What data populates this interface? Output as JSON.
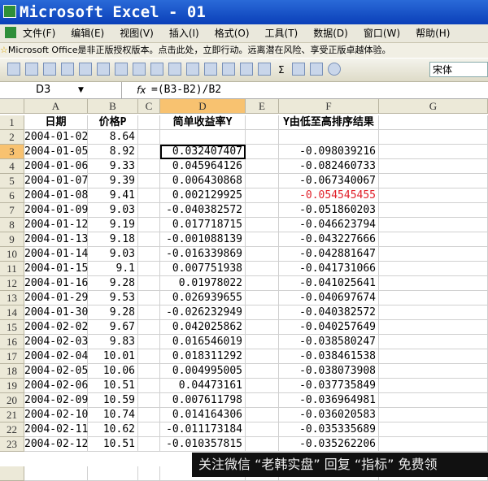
{
  "window": {
    "title": "Microsoft Excel - 01"
  },
  "menu": [
    "文件(F)",
    "编辑(E)",
    "视图(V)",
    "插入(I)",
    "格式(O)",
    "工具(T)",
    "数据(D)",
    "窗口(W)",
    "帮助(H)"
  ],
  "notice": "Microsoft Office是非正版授权版本。点击此处，立即行动。远离潜在风险、享受正版卓越体验。",
  "toolbar": {
    "sigma": "Σ",
    "font": "宋体"
  },
  "formula_bar": {
    "name_box": "D3",
    "fx": "fx",
    "formula": "=(B3-B2)/B2"
  },
  "columns": [
    "A",
    "B",
    "C",
    "D",
    "E",
    "F",
    "G"
  ],
  "headers": {
    "a": "日期",
    "b": "价格P",
    "d": "简单收益率Y",
    "f": "Y由低至高排序结果"
  },
  "rows": [
    {
      "n": "2",
      "a": "2004-01-02",
      "b": "8.64",
      "d": "",
      "f": ""
    },
    {
      "n": "3",
      "a": "2004-01-05",
      "b": "8.92",
      "d": "0.032407407",
      "f": "-0.098039216"
    },
    {
      "n": "4",
      "a": "2004-01-06",
      "b": "9.33",
      "d": "0.045964126",
      "f": "-0.082460733"
    },
    {
      "n": "5",
      "a": "2004-01-07",
      "b": "9.39",
      "d": "0.006430868",
      "f": "-0.067340067"
    },
    {
      "n": "6",
      "a": "2004-01-08",
      "b": "9.41",
      "d": "0.002129925",
      "f": "-0.054545455"
    },
    {
      "n": "7",
      "a": "2004-01-09",
      "b": "9.03",
      "d": "-0.040382572",
      "f": "-0.051860203"
    },
    {
      "n": "8",
      "a": "2004-01-12",
      "b": "9.19",
      "d": "0.017718715",
      "f": "-0.046623794"
    },
    {
      "n": "9",
      "a": "2004-01-13",
      "b": "9.18",
      "d": "-0.001088139",
      "f": "-0.043227666"
    },
    {
      "n": "10",
      "a": "2004-01-14",
      "b": "9.03",
      "d": "-0.016339869",
      "f": "-0.042881647"
    },
    {
      "n": "11",
      "a": "2004-01-15",
      "b": "9.1",
      "d": "0.007751938",
      "f": "-0.041731066"
    },
    {
      "n": "12",
      "a": "2004-01-16",
      "b": "9.28",
      "d": "0.01978022",
      "f": "-0.041025641"
    },
    {
      "n": "13",
      "a": "2004-01-29",
      "b": "9.53",
      "d": "0.026939655",
      "f": "-0.040697674"
    },
    {
      "n": "14",
      "a": "2004-01-30",
      "b": "9.28",
      "d": "-0.026232949",
      "f": "-0.040382572"
    },
    {
      "n": "15",
      "a": "2004-02-02",
      "b": "9.67",
      "d": "0.042025862",
      "f": "-0.040257649"
    },
    {
      "n": "16",
      "a": "2004-02-03",
      "b": "9.83",
      "d": "0.016546019",
      "f": "-0.038580247"
    },
    {
      "n": "17",
      "a": "2004-02-04",
      "b": "10.01",
      "d": "0.018311292",
      "f": "-0.038461538"
    },
    {
      "n": "18",
      "a": "2004-02-05",
      "b": "10.06",
      "d": "0.004995005",
      "f": "-0.038073908"
    },
    {
      "n": "19",
      "a": "2004-02-06",
      "b": "10.51",
      "d": "0.04473161",
      "f": "-0.037735849"
    },
    {
      "n": "20",
      "a": "2004-02-09",
      "b": "10.59",
      "d": "0.007611798",
      "f": "-0.036964981"
    },
    {
      "n": "21",
      "a": "2004-02-10",
      "b": "10.74",
      "d": "0.014164306",
      "f": "-0.036020583"
    },
    {
      "n": "22",
      "a": "2004-02-11",
      "b": "10.62",
      "d": "-0.011173184",
      "f": "-0.035335689"
    },
    {
      "n": "23",
      "a": "2004-02-12",
      "b": "10.51",
      "d": "-0.010357815",
      "f": "-0.035262206"
    }
  ],
  "highlight": {
    "row": "6",
    "color": "#e0202a"
  },
  "watermark": "关注微信 “老韩实盘” 回复 “指标” 免费领"
}
